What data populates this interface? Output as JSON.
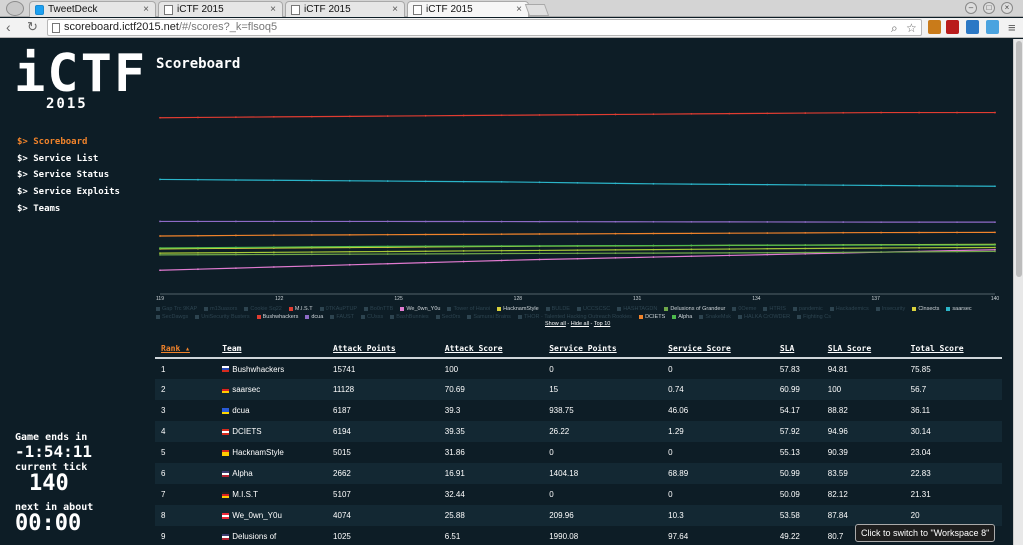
{
  "browser": {
    "tabs": [
      {
        "label": "TweetDeck",
        "icon": "twitter-icon"
      },
      {
        "label": "iCTF 2015",
        "icon": "page-icon"
      },
      {
        "label": "iCTF 2015",
        "icon": "page-icon"
      },
      {
        "label": "iCTF 2015",
        "icon": "page-icon"
      }
    ],
    "url_host": "scoreboard.ictf2015.net",
    "url_path": "/#/scores?_k=flsoq5"
  },
  "sidebar": {
    "logo": "iCTF",
    "year": "2015",
    "nav": [
      "$> Scoreboard",
      "$> Service List",
      "$> Service Status",
      "$> Service Exploits",
      "$> Teams"
    ],
    "game_ends_label": "Game ends in",
    "game_ends_value": "-1:54:11",
    "tick_label": "current tick",
    "tick_value": "140",
    "next_label": "next in about",
    "next_value": "00:00"
  },
  "main": {
    "title": "Scoreboard",
    "legend_links": {
      "show_all": "Show all",
      "hide_all": "Hide all",
      "top10": "Top 10"
    }
  },
  "chart_data": {
    "type": "line",
    "x": [
      119,
      122,
      125,
      128,
      131,
      134,
      137,
      140
    ],
    "xticks": [
      "119",
      "122",
      "125",
      "128",
      "131",
      "134",
      "137",
      "140"
    ],
    "series": [
      {
        "name": "Bushwhackers",
        "color": "#e03c31",
        "values": [
          97,
          97.5,
          98,
          98.5,
          99,
          99.5,
          100,
          100
        ]
      },
      {
        "name": "saarsec",
        "color": "#2bb5c9",
        "values": [
          61,
          60.5,
          60,
          59.5,
          58.5,
          58,
          57.5,
          57
        ]
      },
      {
        "name": "dcua",
        "color": "#8e6bc7",
        "values": [
          36.5,
          36.5,
          36.5,
          36.4,
          36.3,
          36.2,
          36.1,
          36.1
        ]
      },
      {
        "name": "DCIETS",
        "color": "#f0832b",
        "values": [
          28,
          28.5,
          28.8,
          29.1,
          29.4,
          29.7,
          30,
          30.1
        ]
      },
      {
        "name": "HacknamStyle",
        "color": "#d9d23c",
        "values": [
          20.5,
          21,
          21.5,
          22,
          22.3,
          22.6,
          22.9,
          23.1
        ]
      },
      {
        "name": "Alpha",
        "color": "#4dbb4d",
        "values": [
          21,
          21.5,
          22,
          22.2,
          22.4,
          22.6,
          22.7,
          22.8
        ]
      },
      {
        "name": "M.I.S.T",
        "color": "#a8c837",
        "values": [
          18,
          18.5,
          19,
          19.5,
          20,
          20.5,
          21,
          21.3
        ]
      },
      {
        "name": "We_0wn_Y0u",
        "color": "#e07ad0",
        "values": [
          8,
          10,
          12,
          14,
          15.5,
          17,
          18.5,
          20
        ]
      },
      {
        "name": "Delusions of Grandeur",
        "color": "#6fa84a",
        "values": [
          17,
          17.2,
          17.5,
          17.8,
          18,
          18.2,
          18.6,
          19
        ]
      }
    ],
    "ylim": [
      0,
      105
    ],
    "legend": [
      {
        "name": "Gap Trc 9KAP",
        "on": false
      },
      {
        "name": "m13uasors",
        "on": false
      },
      {
        "name": "Cookie Sq22",
        "on": false
      },
      {
        "name": "M.I.S.T",
        "on": true,
        "color": "#e03c31"
      },
      {
        "name": "0TKAuPTUP",
        "on": false
      },
      {
        "name": "Bo0nTTB",
        "on": false
      },
      {
        "name": "We_0wn_Y0u",
        "on": true,
        "color": "#e07ad0"
      },
      {
        "name": "Tower of Hanoi",
        "on": false
      },
      {
        "name": "HacknamStyle",
        "on": true,
        "color": "#d9d23c"
      },
      {
        "name": "BULDE",
        "on": false
      },
      {
        "name": "UCCSCSC",
        "on": false
      },
      {
        "name": "HASHTAGDN",
        "on": false
      },
      {
        "name": "Delusions of Grandeur",
        "on": true,
        "color": "#6fa84a"
      },
      {
        "name": "0Oeme",
        "on": false
      },
      {
        "name": "HTRIS",
        "on": false
      },
      {
        "name": "pandemic",
        "on": false
      },
      {
        "name": "Hackademics",
        "on": false
      },
      {
        "name": "Insecurity",
        "on": false
      },
      {
        "name": "Clnsects",
        "on": true,
        "color": "#d9d23c"
      },
      {
        "name": "saarsec",
        "on": true,
        "color": "#2bb5c9"
      },
      {
        "name": "SecDawgs",
        "on": false
      },
      {
        "name": "UniSecurity Busters",
        "on": false
      },
      {
        "name": "Bushwhackers",
        "on": true,
        "color": "#e03c31"
      },
      {
        "name": "dcua",
        "on": true,
        "color": "#8e6bc7"
      },
      {
        "name": "FAUST",
        "on": false
      },
      {
        "name": "CUsss",
        "on": false
      },
      {
        "name": "BashBunnies",
        "on": false
      },
      {
        "name": "Sect0rs",
        "on": false
      },
      {
        "name": "Samurai Brains",
        "on": false
      },
      {
        "name": "THOR - Talented Hacking Outreach Rookies",
        "on": false
      },
      {
        "name": "DCIETS",
        "on": true,
        "color": "#f0832b"
      },
      {
        "name": "Alpha",
        "on": true,
        "color": "#4dbb4d"
      },
      {
        "name": "SnakeMsk",
        "on": false
      },
      {
        "name": "HALKA CrOWDER",
        "on": false
      },
      {
        "name": "Fighting Cs",
        "on": false
      }
    ]
  },
  "table": {
    "headers": [
      "Rank",
      "Team",
      "Attack Points",
      "Attack Score",
      "Service Points",
      "Service Score",
      "SLA",
      "SLA Score",
      "Total Score"
    ],
    "rows": [
      {
        "rank": "1",
        "team": "Bushwhackers",
        "flag": [
          "#ffffff",
          "#2a4ab8",
          "#d52b1e"
        ],
        "ap": "15741",
        "as": "100",
        "sp": "0",
        "ss": "0",
        "sla": "57.83",
        "slas": "94.81",
        "total": "75.85"
      },
      {
        "rank": "2",
        "team": "saarsec",
        "flag": [
          "#222222",
          "#dd2222",
          "#ffcc00"
        ],
        "ap": "11128",
        "as": "70.69",
        "sp": "15",
        "ss": "0.74",
        "sla": "60.99",
        "slas": "100",
        "total": "56.7"
      },
      {
        "rank": "3",
        "team": "dcua",
        "flag": [
          "#2a5bd7",
          "#2a5bd7",
          "#ffd700"
        ],
        "ap": "6187",
        "as": "39.3",
        "sp": "938.75",
        "ss": "46.06",
        "sla": "54.17",
        "slas": "88.82",
        "total": "36.11"
      },
      {
        "rank": "4",
        "team": "DCIETS",
        "flag": [
          "#d52b1e",
          "#ffffff",
          "#d52b1e"
        ],
        "ap": "6194",
        "as": "39.35",
        "sp": "26.22",
        "ss": "1.29",
        "sla": "57.92",
        "slas": "94.96",
        "total": "30.14"
      },
      {
        "rank": "5",
        "team": "HacknamStyle",
        "flag": [
          "#d52b1e",
          "#ffcc00",
          "#ffcc00"
        ],
        "ap": "5015",
        "as": "31.86",
        "sp": "0",
        "ss": "0",
        "sla": "55.13",
        "slas": "90.39",
        "total": "23.04"
      },
      {
        "rank": "6",
        "team": "Alpha",
        "flag": [
          "#3c3b6e",
          "#ffffff",
          "#b22234"
        ],
        "ap": "2662",
        "as": "16.91",
        "sp": "1404.18",
        "ss": "68.89",
        "sla": "50.99",
        "slas": "83.59",
        "total": "22.83"
      },
      {
        "rank": "7",
        "team": "M.I.S.T",
        "flag": [
          "#222222",
          "#dd2222",
          "#ffcc00"
        ],
        "ap": "5107",
        "as": "32.44",
        "sp": "0",
        "ss": "0",
        "sla": "50.09",
        "slas": "82.12",
        "total": "21.31"
      },
      {
        "rank": "8",
        "team": "We_0wn_Y0u",
        "flag": [
          "#ed2939",
          "#ffffff",
          "#ed2939"
        ],
        "ap": "4074",
        "as": "25.88",
        "sp": "209.96",
        "ss": "10.3",
        "sla": "53.58",
        "slas": "87.84",
        "total": "20"
      },
      {
        "rank": "9",
        "team": "Delusions of",
        "flag": [
          "#3c3b6e",
          "#ffffff",
          "#b22234"
        ],
        "ap": "1025",
        "as": "6.51",
        "sp": "1990.08",
        "ss": "97.64",
        "sla": "49.22",
        "slas": "80.7",
        "total": "19.06"
      }
    ]
  },
  "tooltip": "Click to switch to \"Workspace 8\""
}
